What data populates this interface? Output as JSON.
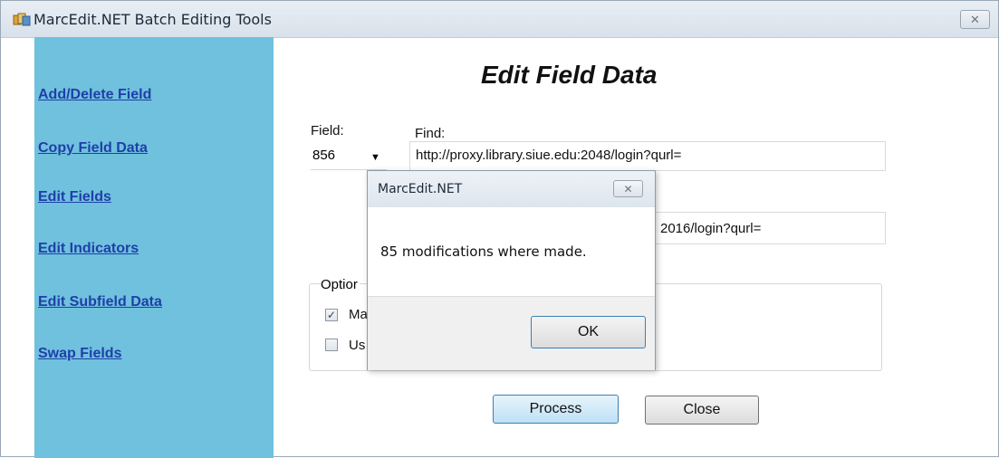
{
  "window": {
    "title": "MarcEdit.NET Batch Editing Tools",
    "close_glyph": "✕"
  },
  "sidebar": {
    "items": [
      {
        "label": "Add/Delete Field"
      },
      {
        "label": "Copy Field Data"
      },
      {
        "label": "Edit Fields"
      },
      {
        "label": "Edit Indicators"
      },
      {
        "label": "Edit Subfield Data"
      },
      {
        "label": "Swap Fields"
      }
    ]
  },
  "main": {
    "heading": "Edit Field Data",
    "field_label": "Field:",
    "field_value": "856",
    "find_label": "Find:",
    "find_value": "http://proxy.library.siue.edu:2048/login?qurl=",
    "replace_value": "2016/login?qurl=",
    "options_label": "Optior",
    "option1_label": "Ma",
    "option1_checked": true,
    "option2_label": "Us",
    "option2_checked": false,
    "process_label": "Process",
    "close_label": "Close"
  },
  "dialog": {
    "title": "MarcEdit.NET",
    "message": "85 modifications where made.",
    "ok_label": "OK",
    "close_glyph": "✕"
  },
  "colors": {
    "sidebar_bg": "#6fc1de",
    "link": "#1f3fa8",
    "primary_button": "#bfe0f5"
  }
}
